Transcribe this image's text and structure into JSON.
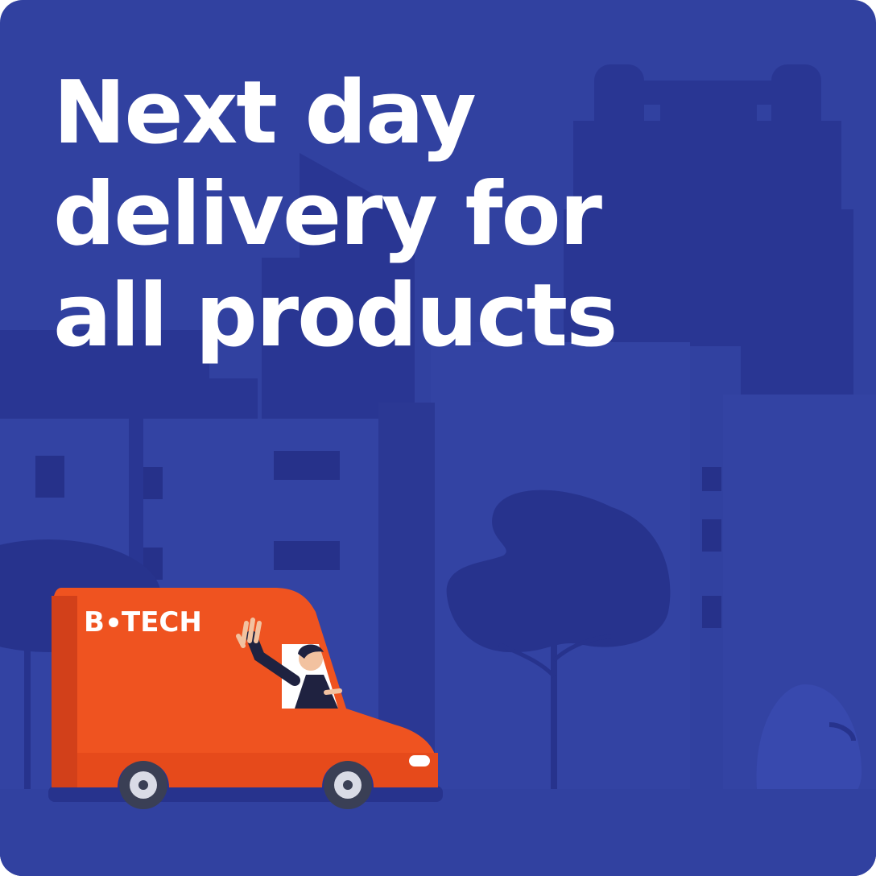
{
  "headline": {
    "lines": [
      "Next day",
      "delivery for",
      "all products"
    ]
  },
  "van": {
    "brand_logo": "B•TECH"
  },
  "colors": {
    "background": "#3141a0",
    "building_dark": "#27338c",
    "building_mid": "#3545a6",
    "van_body": "#ef5320",
    "van_shadow": "#d2401a",
    "headline_text": "#ffffff"
  },
  "icons": [
    "city-skyline-illustration",
    "tree-illustration",
    "delivery-van-illustration",
    "waving-driver-illustration",
    "van-wheel-icon"
  ]
}
